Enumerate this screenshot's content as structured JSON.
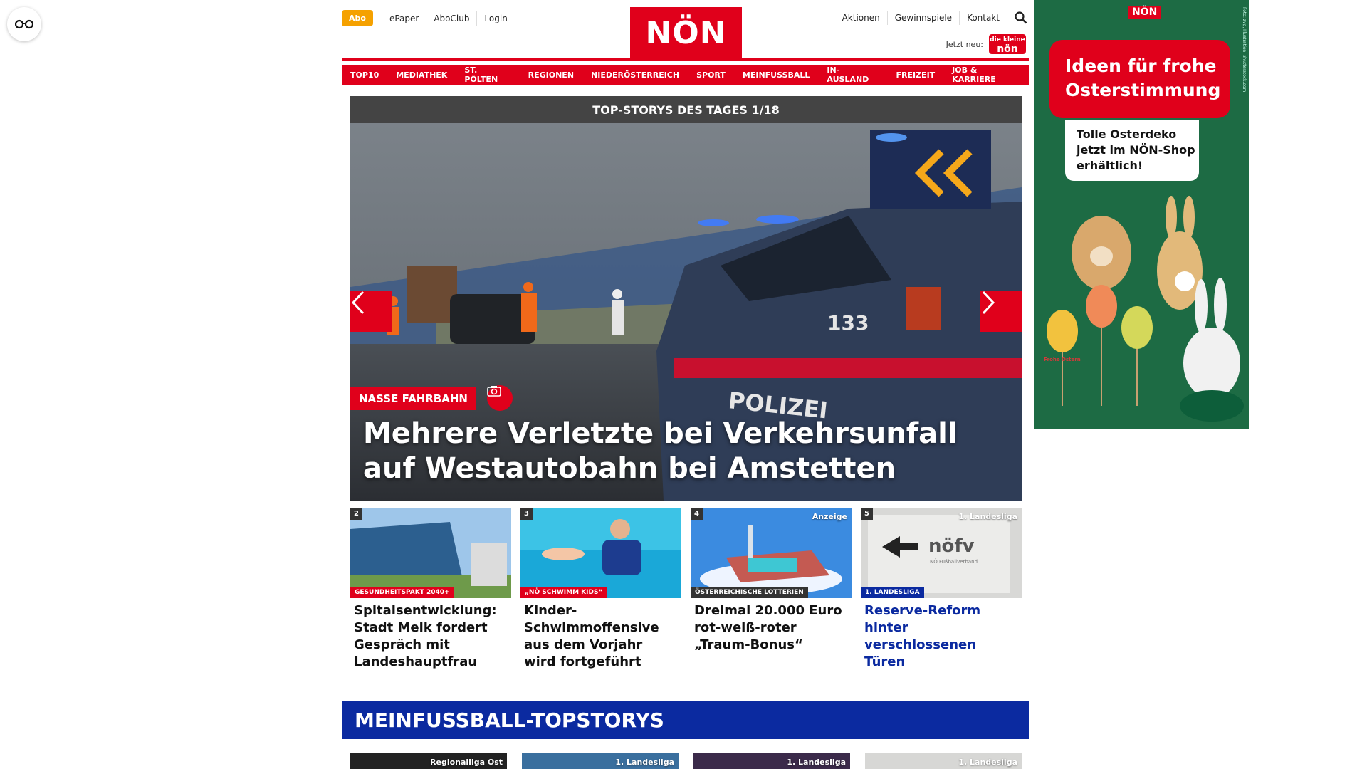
{
  "util": {
    "abo": "Abo",
    "links": [
      "ePaper",
      "AboClub",
      "Login"
    ]
  },
  "logo": "NÖN",
  "right_links": [
    "Aktionen",
    "Gewinnspiele",
    "Kontakt"
  ],
  "jetzt": {
    "label": "Jetzt neu:",
    "badge_top": "die kleine",
    "badge_bottom": "nön"
  },
  "nav": [
    "TOP10",
    "MEDIATHEK",
    "ST. PÖLTEN",
    "REGIONEN",
    "NIEDERÖSTERREICH",
    "SPORT",
    "MEINFUSSBALL",
    "IN-AUSLAND",
    "FREIZEIT",
    "JOB & KARRIERE"
  ],
  "hero": {
    "bar": "TOP-STORYS DES TAGES 1/18",
    "tag": "NASSE FAHRBAHN",
    "title": "Mehrere Verletzte bei Verkehrsunfall auf Westautobahn bei Amstetten",
    "van_text": "POLIZEI",
    "van_number": "133"
  },
  "cards": [
    {
      "num": "2",
      "badge": "GESUNDHEITSPAKT 2040+",
      "badge_color": "#e0001b",
      "corner": "",
      "title": "Spitalsentwicklung: Stadt Melk fordert Gespräch mit Landeshauptfrau",
      "blue": false
    },
    {
      "num": "3",
      "badge": "„NÖ SCHWIMM KIDS“",
      "badge_color": "#e0001b",
      "corner": "",
      "title": "Kinder-Schwimmoffensive aus dem Vorjahr wird fortgeführt",
      "blue": false
    },
    {
      "num": "4",
      "badge": "ÖSTERREICHISCHE LOTTERIEN",
      "badge_color": "#333333",
      "corner": "Anzeige",
      "title": "Dreimal 20.000 Euro rot-weiß-roter „Traum-Bonus“",
      "blue": false
    },
    {
      "num": "5",
      "badge": "1. LANDESLIGA",
      "badge_color": "#0b2aa0",
      "corner": "1. Landesliga",
      "title": "Reserve-Reform hinter verschlossenen Türen",
      "blue": true
    }
  ],
  "section_title": "MEINFUSSBALL-TOPSTORYS",
  "cards2": [
    "Regionalliga Ost",
    "1. Landesliga",
    "1. Landesliga",
    "1. Landesliga"
  ],
  "ad": {
    "logo": "NÖN",
    "headline": "Ideen für frohe Osterstimmung",
    "sub": "Tolle Osterdeko jetzt im NÖN-Shop erhältlich!",
    "credit": "Foto: zvg, Illustration: shutterstock.com",
    "egg_text": "Frohe Ostern"
  },
  "nofv": {
    "name": "nöfv",
    "sub": "NÖ Fußballverband"
  },
  "colors": {
    "brand_red": "#e0001b",
    "sport_blue": "#0b2aa0",
    "abo_orange": "#f5a100"
  }
}
